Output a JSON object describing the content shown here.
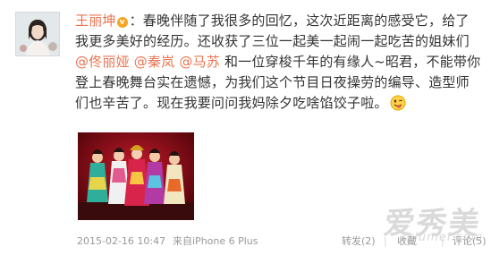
{
  "post": {
    "author": "王丽坤",
    "text_parts": {
      "p1": "：春晚伴随了我很多的回忆，这次近距离的感受它，给了我更多美好的经历。还收获了三位一起美一起闹一起吃苦的姐妹们",
      "m1": "@佟丽娅",
      "m2": "@秦岚",
      "m3": "@马苏",
      "p2": "和一位穿梭千年的有缘人~昭君，不能带你登上春晚舞台实在遗憾，为我们这个节目日夜操劳的编导、造型师们也辛苦了。现在我要问问我妈除夕吃啥馅饺子啦。"
    },
    "emoji_icon": "wink-tongue-emoji"
  },
  "footer": {
    "time": "2015-02-16 10:47",
    "source": "来自iPhone 6 Plus",
    "forward": "转发(2)",
    "favorite": "收藏",
    "comment": "评论(5)",
    "separator": "|"
  },
  "watermark": {
    "cn": "爱秀美",
    "en": "ixiumei.com"
  },
  "colors": {
    "accent": "#eb7350",
    "text": "#333333",
    "meta": "#999999"
  }
}
